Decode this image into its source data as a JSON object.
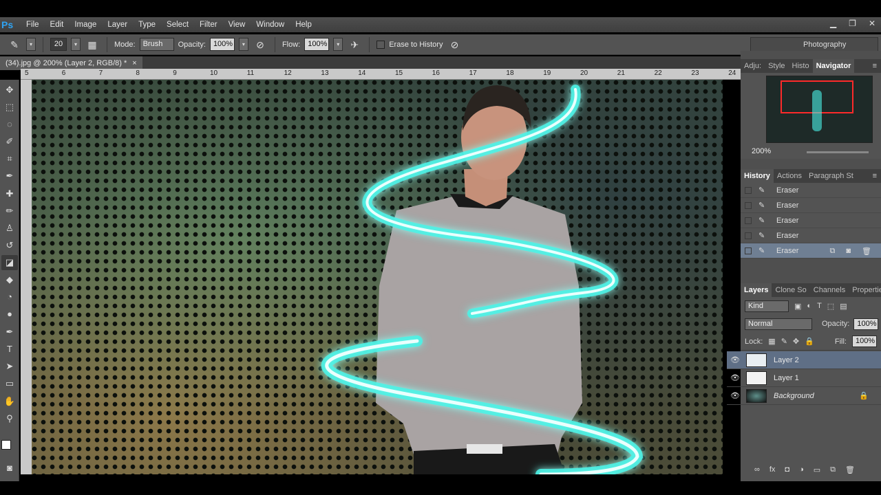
{
  "app": {
    "logo": "Ps"
  },
  "menu": [
    "File",
    "Edit",
    "Image",
    "Layer",
    "Type",
    "Select",
    "Filter",
    "View",
    "Window",
    "Help"
  ],
  "options": {
    "brush_size": "20",
    "mode_label": "Mode:",
    "mode_value": "Brush",
    "opacity_label": "Opacity:",
    "opacity_value": "100%",
    "flow_label": "Flow:",
    "flow_value": "100%",
    "erase_history_label": "Erase to History",
    "workspace": "Photography"
  },
  "document": {
    "tab_title": "(34).jpg @ 200% (Layer 2, RGB/8) *",
    "ruler_ticks": [
      "5",
      "6",
      "7",
      "8",
      "9",
      "10",
      "11",
      "12",
      "13",
      "14",
      "15",
      "16",
      "17",
      "18",
      "19",
      "20",
      "21",
      "22",
      "23",
      "24"
    ]
  },
  "navigator": {
    "tabs": [
      "Adju:",
      "Style",
      "Histo",
      "Navigator"
    ],
    "zoom": "200%"
  },
  "history": {
    "tabs": [
      "History",
      "Actions",
      "Paragraph St"
    ],
    "items": [
      "Eraser",
      "Eraser",
      "Eraser",
      "Eraser",
      "Eraser"
    ],
    "selected_index": 4
  },
  "layers_panel": {
    "tabs": [
      "Layers",
      "Clone So",
      "Channels",
      "Propertie"
    ],
    "filter_kind": "Kind",
    "blend_mode": "Normal",
    "opacity_label": "Opacity:",
    "opacity_value": "100%",
    "lock_label": "Lock:",
    "fill_label": "Fill:",
    "fill_value": "100%",
    "layers": [
      {
        "name": "Layer 2",
        "selected": true
      },
      {
        "name": "Layer 1",
        "selected": false
      },
      {
        "name": "Background",
        "selected": false,
        "locked": true
      }
    ]
  },
  "colors": {
    "accent": "#2fa3f2",
    "glow": "#49f2e6",
    "foreground": "#ffffff",
    "background_swatch": "#36c23a"
  }
}
